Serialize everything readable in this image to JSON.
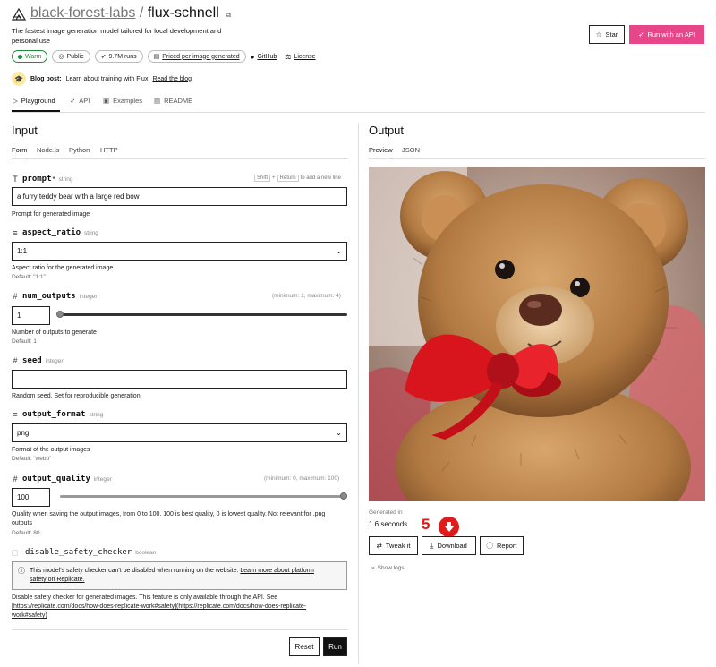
{
  "header": {
    "owner": "black-forest-labs",
    "separator": "/",
    "model": "flux-schnell",
    "description_line1": "The fastest image generation model tailored for local development and",
    "description_line2": "personal use",
    "badges": {
      "warm": "Warm",
      "public": "Public",
      "runs": "9.7M runs",
      "pricing": "Priced per image generated",
      "github": "GitHub",
      "license": "License"
    },
    "star_label": "Star",
    "api_label": "Run with an API",
    "blog_prefix": "Blog post:",
    "blog_text": "Learn about training with Flux",
    "blog_link": "Read the blog"
  },
  "nav": {
    "tabs": [
      "Playground",
      "API",
      "Examples",
      "README"
    ]
  },
  "input": {
    "title": "Input",
    "tabs": [
      "Form",
      "Node.js",
      "Python",
      "HTTP"
    ],
    "prompt": {
      "name": "prompt",
      "required_mark": "*",
      "type": "string",
      "hint_key1": "Shift",
      "hint_plus": "+",
      "hint_key2": "Return",
      "hint_text": "to add a new line",
      "value": "a furry teddy bear with a large red bow",
      "description": "Prompt for generated image"
    },
    "aspect_ratio": {
      "name": "aspect_ratio",
      "type": "string",
      "value": "1:1",
      "description": "Aspect ratio for the generated image",
      "default": "Default: \"1:1\""
    },
    "num_outputs": {
      "name": "num_outputs",
      "type": "integer",
      "range": "(minimum: 1, maximum: 4)",
      "value": "1",
      "level": 0,
      "description": "Number of outputs to generate",
      "default": "Default: 1"
    },
    "seed": {
      "name": "seed",
      "type": "integer",
      "value": "",
      "description": "Random seed. Set for reproducible generation"
    },
    "output_format": {
      "name": "output_format",
      "type": "string",
      "value": "png",
      "description": "Format of the output images",
      "default": "Default: \"webp\""
    },
    "output_quality": {
      "name": "output_quality",
      "type": "integer",
      "range": "(minimum: 0, maximum: 100)",
      "value": "100",
      "level": 1,
      "description_line1": "Quality when saving the output images, from 0 to 100. 100 is best quality, 0 is lowest quality. Not relevant for .png",
      "description_line2": "outputs",
      "default": "Default: 80"
    },
    "safety": {
      "name": "disable_safety_checker",
      "type": "boolean",
      "notice_text": "This model's safety checker can't be disabled when running on the website.",
      "notice_link_line1": "Learn more about platform",
      "notice_link_line2": "safety on Replicate.",
      "description_line1": "Disable safety checker for generated images. This feature is only available through the API. See",
      "description_line2": "[https://replicate.com/docs/how-does-replicate-work#safety](https://replicate.com/docs/how-does-replicate-",
      "description_line3": "work#safety)"
    },
    "reset_label": "Reset",
    "run_label": "Run"
  },
  "output": {
    "title": "Output",
    "tabs": [
      "Preview",
      "JSON"
    ],
    "generated_label": "Generated in",
    "generated_value": "1.6 seconds",
    "annotation_number": "5",
    "tweak_label": "Tweak it",
    "download_label": "Download",
    "report_label": "Report",
    "logs_label": "Show logs"
  },
  "colors": {
    "accent_pink": "#e8468a",
    "warm_green": "#1f8a3b",
    "annotation_red": "#e01b1b"
  }
}
